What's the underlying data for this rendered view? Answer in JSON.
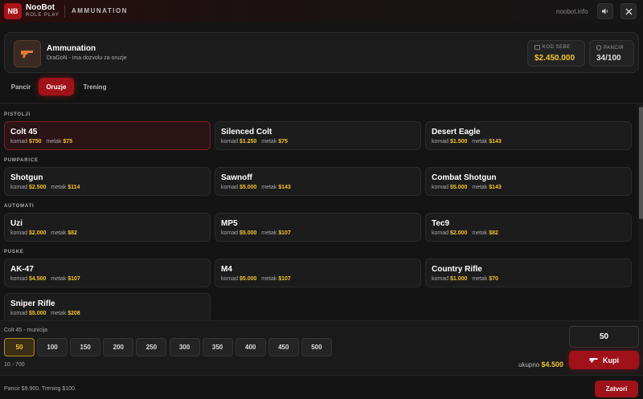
{
  "app": {
    "logo_text": "NB",
    "brand_name": "NooBot",
    "brand_sub": "ROLE PLAY",
    "window_title": "AMMUNATION",
    "url": "noobot.info",
    "sound_icon": "speaker-icon",
    "close_icon": "close-icon"
  },
  "header": {
    "icon": "gun-icon",
    "title": "Ammunation",
    "subtitle": "DraGoN - ima dozvolu za oruzje",
    "money_label": "KOD SEBE",
    "money_value": "$2.450.000",
    "armor_label": "PANCIR",
    "armor_value": "34/100",
    "money_color": "#f3c430"
  },
  "tabs": [
    {
      "label": "Pancir",
      "active": false
    },
    {
      "label": "Oruzje",
      "active": true
    },
    {
      "label": "Trening",
      "active": false
    }
  ],
  "sections": [
    {
      "label": "PISTOLJI",
      "items": [
        {
          "name": "Colt 45",
          "piece_label": "komad",
          "piece_price": "$750",
          "ammo_label": "metak",
          "ammo_price": "$75",
          "selected": true
        },
        {
          "name": "Silenced Colt",
          "piece_label": "komad",
          "piece_price": "$1.250",
          "ammo_label": "metak",
          "ammo_price": "$75"
        },
        {
          "name": "Desert Eagle",
          "piece_label": "komad",
          "piece_price": "$1.500",
          "ammo_label": "metak",
          "ammo_price": "$143"
        }
      ]
    },
    {
      "label": "PUMPARICE",
      "items": [
        {
          "name": "Shotgun",
          "piece_label": "komad",
          "piece_price": "$2.500",
          "ammo_label": "metak",
          "ammo_price": "$114"
        },
        {
          "name": "Sawnoff",
          "piece_label": "komad",
          "piece_price": "$5.000",
          "ammo_label": "metak",
          "ammo_price": "$143"
        },
        {
          "name": "Combat Shotgun",
          "piece_label": "komad",
          "piece_price": "$5.000",
          "ammo_label": "metak",
          "ammo_price": "$143"
        }
      ]
    },
    {
      "label": "AUTOMATI",
      "items": [
        {
          "name": "Uzi",
          "piece_label": "komad",
          "piece_price": "$2.000",
          "ammo_label": "metak",
          "ammo_price": "$82"
        },
        {
          "name": "MP5",
          "piece_label": "komad",
          "piece_price": "$5.000",
          "ammo_label": "metak",
          "ammo_price": "$107"
        },
        {
          "name": "Tec9",
          "piece_label": "komad",
          "piece_price": "$2.000",
          "ammo_label": "metak",
          "ammo_price": "$82"
        }
      ]
    },
    {
      "label": "PUSKE",
      "items": [
        {
          "name": "AK-47",
          "piece_label": "komad",
          "piece_price": "$4.500",
          "ammo_label": "metak",
          "ammo_price": "$107"
        },
        {
          "name": "M4",
          "piece_label": "komad",
          "piece_price": "$5.000",
          "ammo_label": "metak",
          "ammo_price": "$107"
        },
        {
          "name": "Country Rifle",
          "piece_label": "komad",
          "piece_price": "$1.000",
          "ammo_label": "metak",
          "ammo_price": "$70"
        },
        {
          "name": "Sniper Rifle",
          "piece_label": "komad",
          "piece_price": "$5.000",
          "ammo_label": "metak",
          "ammo_price": "$208"
        }
      ]
    }
  ],
  "ammo": {
    "label": "Colt 45 - municija",
    "options": [
      "50",
      "100",
      "150",
      "200",
      "250",
      "300",
      "350",
      "400",
      "450",
      "500"
    ],
    "selected": "50",
    "range": "10 - 700",
    "quantity": "50",
    "buy_label": "Kupi",
    "total_label": "ukupno",
    "total_value": "$4.500"
  },
  "footer": {
    "info": "Pancir $9.900. Trening $100.",
    "close_label": "Zatvori"
  }
}
